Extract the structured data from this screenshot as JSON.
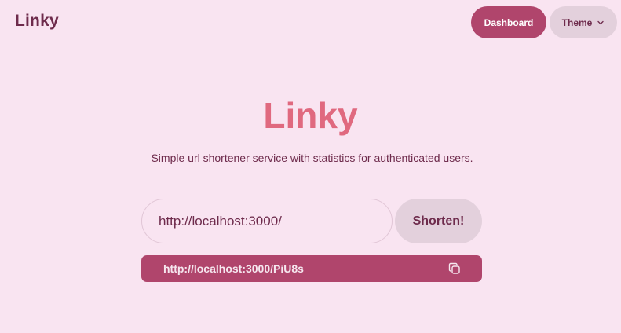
{
  "navbar": {
    "brand": "Linky",
    "dashboard_label": "Dashboard",
    "theme_label": "Theme"
  },
  "hero": {
    "title": "Linky",
    "description": "Simple url shortener service with statistics for authenticated users."
  },
  "form": {
    "url_value": "http://localhost:3000/",
    "submit_label": "Shorten!"
  },
  "result": {
    "short_url": "http://localhost:3000/PiU8s"
  },
  "icons": {
    "theme_dropdown": "chevron-down-icon",
    "copy": "copy-icon"
  },
  "colors": {
    "background": "#f9e4f1",
    "primary": "#b0456c",
    "accent": "#e0697f",
    "neutral": "#e3d0dc",
    "text": "#6e2b4c"
  }
}
